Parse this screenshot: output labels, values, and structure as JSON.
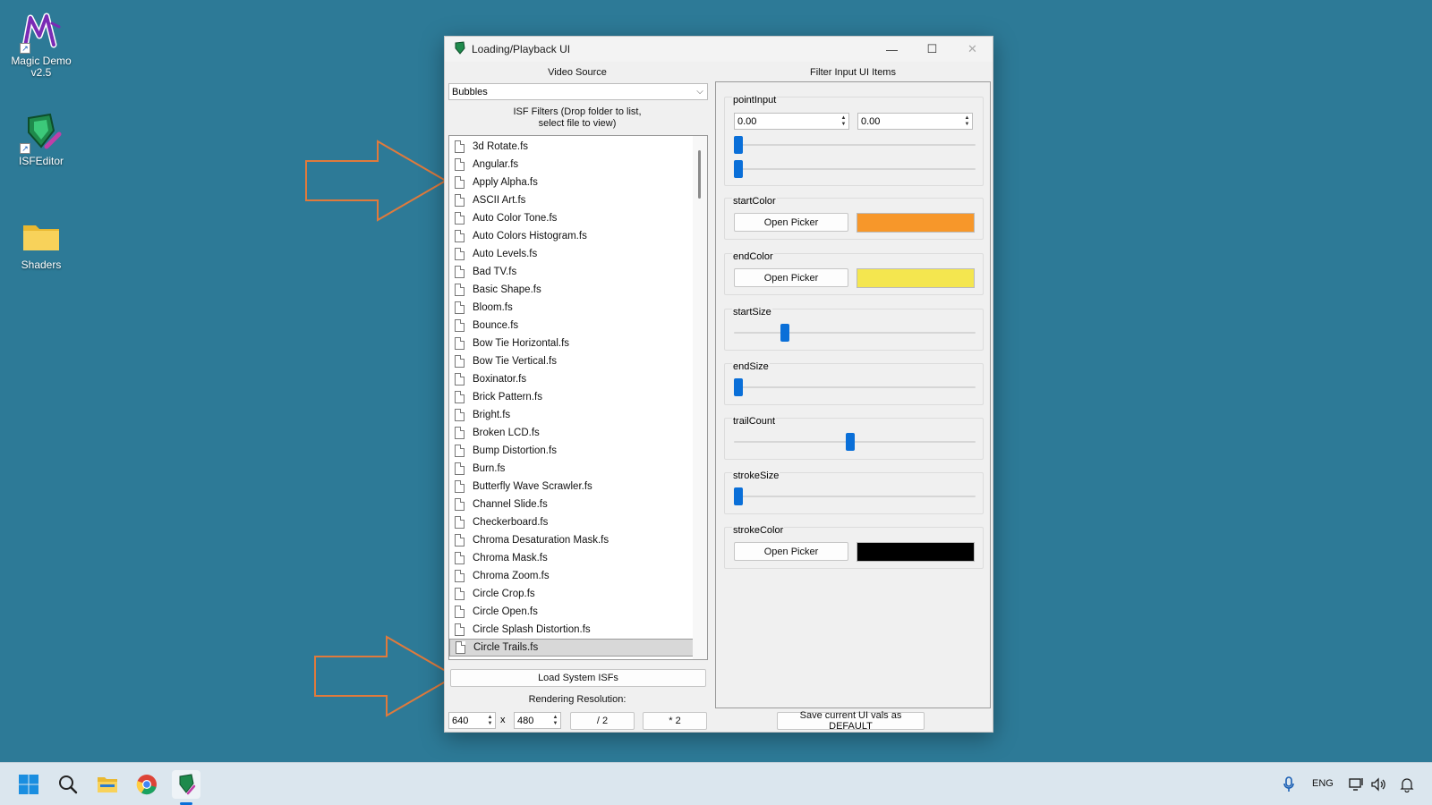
{
  "desktop": {
    "icons": [
      {
        "label": "Magic Demo v2.5"
      },
      {
        "label": "ISFEditor"
      },
      {
        "label": "Shaders"
      }
    ]
  },
  "window": {
    "title": "Loading/Playback UI",
    "controls": {
      "minimize": "—",
      "maximize": "☐",
      "close": "✕"
    }
  },
  "left": {
    "video_source_caption": "Video Source",
    "video_source_value": "Bubbles",
    "isf_caption_line1": "ISF Filters (Drop folder to list,",
    "isf_caption_line2": "select file to view)",
    "files": [
      "3d Rotate.fs",
      "Angular.fs",
      "Apply Alpha.fs",
      "ASCII Art.fs",
      "Auto Color Tone.fs",
      "Auto Colors Histogram.fs",
      "Auto Levels.fs",
      "Bad TV.fs",
      "Basic Shape.fs",
      "Bloom.fs",
      "Bounce.fs",
      "Bow Tie Horizontal.fs",
      "Bow Tie Vertical.fs",
      "Boxinator.fs",
      "Brick Pattern.fs",
      "Bright.fs",
      "Broken LCD.fs",
      "Bump Distortion.fs",
      "Burn.fs",
      "Butterfly Wave Scrawler.fs",
      "Channel Slide.fs",
      "Checkerboard.fs",
      "Chroma Desaturation Mask.fs",
      "Chroma Mask.fs",
      "Chroma Zoom.fs",
      "Circle Crop.fs",
      "Circle Open.fs",
      "Circle Splash Distortion.fs",
      "Circle Trails.fs"
    ],
    "selected_file": "Circle Trails.fs",
    "load_system_label": "Load System ISFs",
    "rendering_caption": "Rendering Resolution:",
    "width_value": "640",
    "x_label": "x",
    "height_value": "480",
    "half_label": "/ 2",
    "double_label": "* 2"
  },
  "right": {
    "caption": "Filter Input UI Items",
    "point_input": {
      "label": "pointInput",
      "x_value": "0.00",
      "y_value": "0.00",
      "x_slider": 0.0,
      "y_slider": 0.0
    },
    "start_color": {
      "label": "startColor",
      "button": "Open Picker",
      "color": "#f7972a"
    },
    "end_color": {
      "label": "endColor",
      "button": "Open Picker",
      "color": "#f4e64f"
    },
    "start_size": {
      "label": "startSize",
      "level": 0.2
    },
    "end_size": {
      "label": "endSize",
      "level": 0.0
    },
    "trail_count": {
      "label": "trailCount",
      "level": 0.48
    },
    "stroke_size": {
      "label": "strokeSize",
      "level": 0.0
    },
    "stroke_color": {
      "label": "strokeColor",
      "button": "Open Picker",
      "color": "#000000"
    },
    "save_default_label": "Save current UI vals as DEFAULT"
  },
  "taskbar": {
    "language": "ENG"
  },
  "colors": {
    "desktop": "#2d7a97",
    "accent": "#0a6fd8",
    "arrow": "#e07a3c"
  }
}
